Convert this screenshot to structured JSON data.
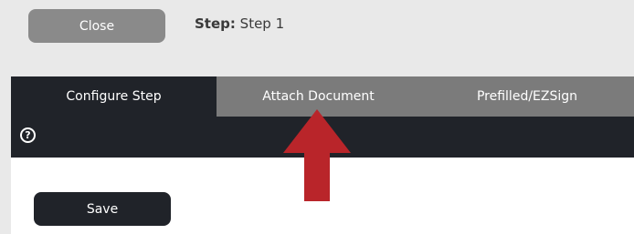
{
  "header": {
    "close_label": "Close",
    "step_label": "Step:",
    "step_value": "Step 1"
  },
  "tabs": [
    {
      "label": "Configure Step",
      "active": true
    },
    {
      "label": "Attach Document",
      "active": false
    },
    {
      "label": "Prefilled/EZSign",
      "active": false
    }
  ],
  "toolbar": {
    "help_icon": "question-circle",
    "help_glyph": "?"
  },
  "content": {
    "save_label": "Save"
  },
  "annotation": {
    "arrow_color": "#b9252a",
    "arrow_direction": "up",
    "points_to": "Attach Document"
  },
  "colors": {
    "dark": "#202329",
    "tab_inactive": "#7b7b7b",
    "close_button": "#8a8a8a",
    "background": "#e9e9e9"
  }
}
